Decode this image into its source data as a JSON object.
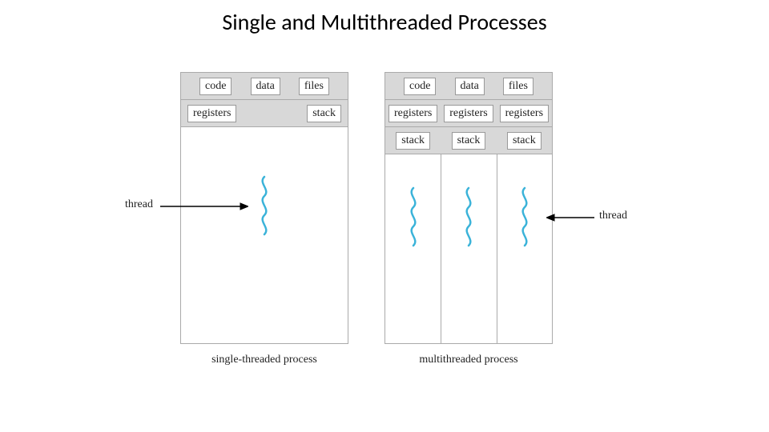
{
  "title": "Single and Multithreaded Processes",
  "labels": {
    "code": "code",
    "data": "data",
    "files": "files",
    "registers": "registers",
    "stack": "stack",
    "thread": "thread"
  },
  "captions": {
    "single": "single-threaded process",
    "multi": "multithreaded process"
  },
  "colors": {
    "thread_stroke": "#3bb3d9"
  }
}
